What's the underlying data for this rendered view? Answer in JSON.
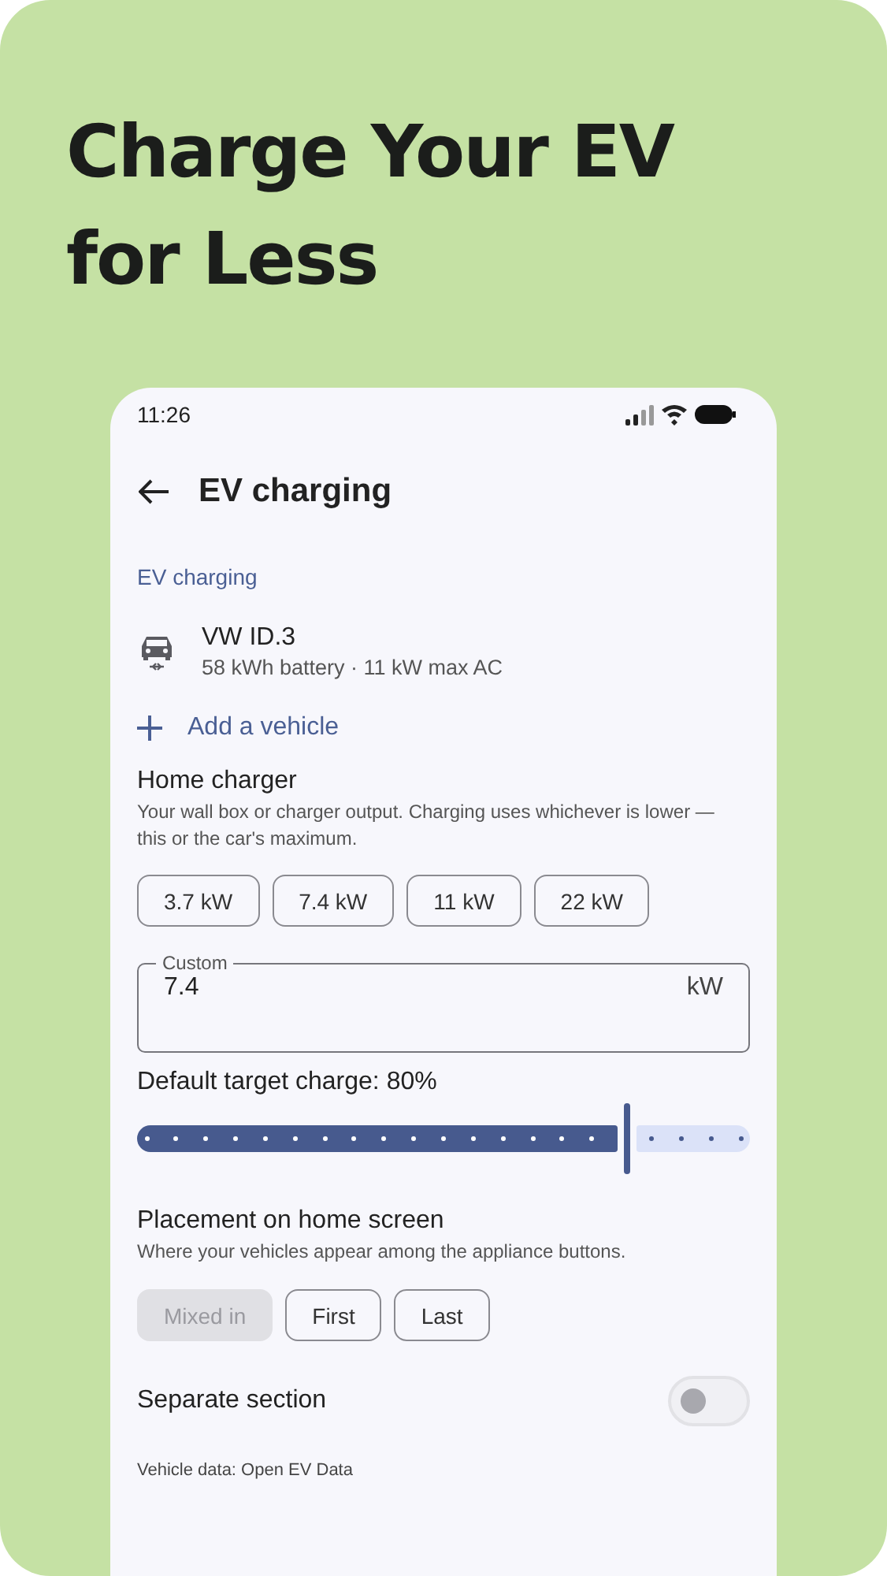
{
  "headline": "Charge Your EV for Less",
  "status_bar": {
    "time": "11:26"
  },
  "app_bar": {
    "title": "EV charging"
  },
  "section_title": "EV charging",
  "vehicles": [
    {
      "name": "VW ID.3",
      "details": "58 kWh battery · 11 kW max AC"
    }
  ],
  "add_vehicle": "Add a vehicle",
  "home_charger": {
    "title": "Home charger",
    "description": "Your wall box or charger output. Charging uses whichever is lower — this or the car's maximum.",
    "presets": [
      {
        "label": "3.7 kW",
        "selected": false
      },
      {
        "label": "7.4 kW",
        "selected": false
      },
      {
        "label": "11 kW",
        "selected": false
      },
      {
        "label": "22 kW",
        "selected": false
      }
    ],
    "custom": {
      "label": "Custom",
      "value": "7.4",
      "suffix": "kW"
    }
  },
  "target_charge": {
    "label": "Default target charge: 80%",
    "level": 0.8
  },
  "placement": {
    "title": "Placement on home screen",
    "description": "Where your vehicles appear among the appliance buttons.",
    "options": [
      {
        "label": "Mixed in",
        "selected": true
      },
      {
        "label": "First",
        "selected": false
      },
      {
        "label": "Last",
        "selected": false
      }
    ]
  },
  "separate_section": {
    "label": "Separate section",
    "on": false
  },
  "footer": "Vehicle data: Open EV Data"
}
